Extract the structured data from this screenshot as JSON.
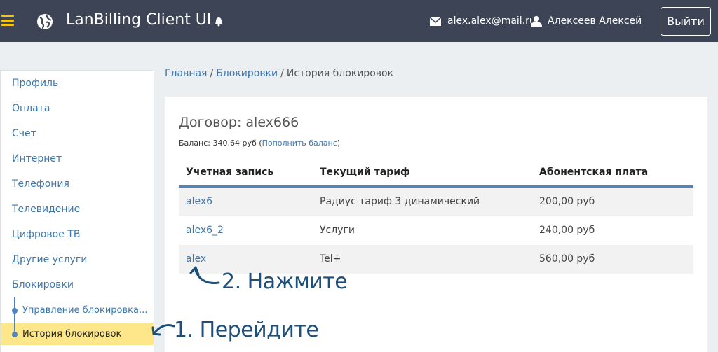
{
  "header": {
    "app_title": "LanBilling Client UI",
    "email": "alex.alex@mail.ru",
    "username": "Алексеев Алексей",
    "logout_label": "Выйти"
  },
  "sidebar": {
    "items": [
      {
        "label": "Профиль"
      },
      {
        "label": "Оплата"
      },
      {
        "label": "Счет"
      },
      {
        "label": "Интернет"
      },
      {
        "label": "Телефония"
      },
      {
        "label": "Телевидение"
      },
      {
        "label": "Цифровое ТВ"
      },
      {
        "label": "Другие услуги"
      },
      {
        "label": "Блокировки"
      }
    ],
    "subitems": [
      {
        "label": "Управление блокировка..."
      },
      {
        "label": "История блокировок",
        "active": true
      }
    ]
  },
  "breadcrumb": {
    "home": "Главная",
    "section": "Блокировки",
    "current": "История блокировок",
    "separator": "/"
  },
  "contract": {
    "title": "Договор: alex666",
    "balance_text": "Баланс: 340,64  руб (",
    "topup_link": "Пополнить баланс",
    "balance_close": ")"
  },
  "table": {
    "headers": [
      "Учетная запись",
      "Текущий тариф",
      "Абонентская плата"
    ],
    "rows": [
      [
        "alex6",
        "Радиус тариф 3 динамический",
        "200,00 руб"
      ],
      [
        "alex6_2",
        "Услуги",
        "240,00 руб"
      ],
      [
        "alex",
        "Tel+",
        "560,00 руб"
      ]
    ]
  },
  "annotations": {
    "step1": "1. Перейдите",
    "step2": "2. Нажмите"
  },
  "colors": {
    "header_bg": "#3d4455",
    "accent_yellow": "#f2c418",
    "link_blue": "#3d77ad",
    "highlight": "#fde78a",
    "annotation": "#1d4f7c"
  }
}
